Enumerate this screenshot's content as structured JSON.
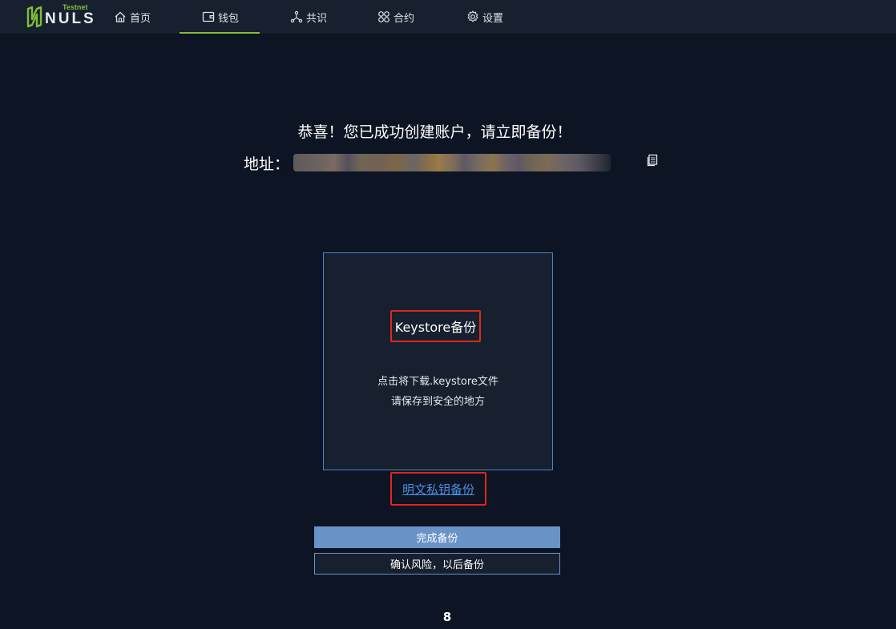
{
  "header": {
    "logo": {
      "text": "NULS",
      "env": "Testnet"
    },
    "nav": [
      {
        "label": "首页",
        "icon": "home-icon"
      },
      {
        "label": "钱包",
        "icon": "wallet-icon",
        "active": true
      },
      {
        "label": "共识",
        "icon": "consensus-icon"
      },
      {
        "label": "合约",
        "icon": "contract-icon"
      },
      {
        "label": "设置",
        "icon": "gear-icon"
      }
    ],
    "colors": {
      "accent": "#82bd39",
      "background": "#17202e"
    }
  },
  "main": {
    "title": "恭喜！您已成功创建账户，请立即备份！",
    "address_label": "地址：",
    "address_value": "",
    "copy_icon": "copy-icon",
    "keystore_card": {
      "title": "Keystore备份",
      "line1": "点击将下载.keystore文件",
      "line2": "请保存到安全的地方"
    },
    "plain_backup_link": "明文私钥备份",
    "done_button": "完成备份",
    "later_button": "确认风险，以后备份",
    "page_number": "8",
    "colors": {
      "page_bg": "#0d1423",
      "link": "#4a8fe0",
      "button": "#6a93c8",
      "highlight_box": "#e1261c"
    }
  }
}
